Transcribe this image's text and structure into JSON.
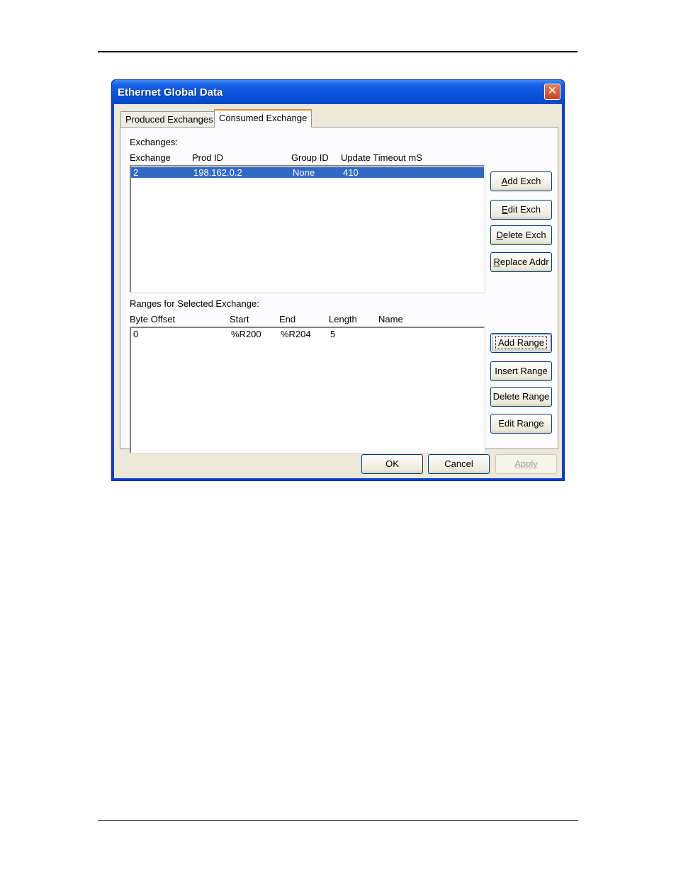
{
  "window": {
    "title": "Ethernet Global Data",
    "close_glyph": "✕"
  },
  "tabs": [
    {
      "label": "Produced Exchanges",
      "active": false
    },
    {
      "label": "Consumed Exchange",
      "active": true
    }
  ],
  "exchanges": {
    "section_label": "Exchanges:",
    "columns": [
      "Exchange",
      "Prod ID",
      "Group ID",
      "Update Timeout mS"
    ],
    "rows": [
      {
        "exchange": "2",
        "prod_id": "198.162.0.2",
        "group_id": "None",
        "update_timeout": "410",
        "selected": true
      }
    ],
    "buttons": {
      "add": {
        "accel": "A",
        "rest": "dd Exch"
      },
      "edit": {
        "accel": "E",
        "rest": "dit Exch"
      },
      "delete": {
        "accel": "D",
        "rest": "elete Exch"
      },
      "replace": {
        "accel": "R",
        "rest": "eplace Addr"
      }
    }
  },
  "ranges": {
    "section_label": "Ranges for Selected Exchange:",
    "columns": [
      "Byte Offset",
      "Start",
      "End",
      "Length",
      "Name"
    ],
    "rows": [
      {
        "byte_offset": "0",
        "start": "%R200",
        "end": "%R204",
        "length": "5",
        "name": ""
      }
    ],
    "buttons": {
      "add": "Add Range",
      "insert": "Insert Range",
      "delete": "Delete Range",
      "edit": "Edit Range"
    }
  },
  "dialog_buttons": {
    "ok": "OK",
    "cancel": "Cancel",
    "apply": "Apply"
  },
  "colors": {
    "titlebar": "#0a52dc",
    "selection": "#316ac5",
    "dialog_bg": "#ece9d8"
  }
}
